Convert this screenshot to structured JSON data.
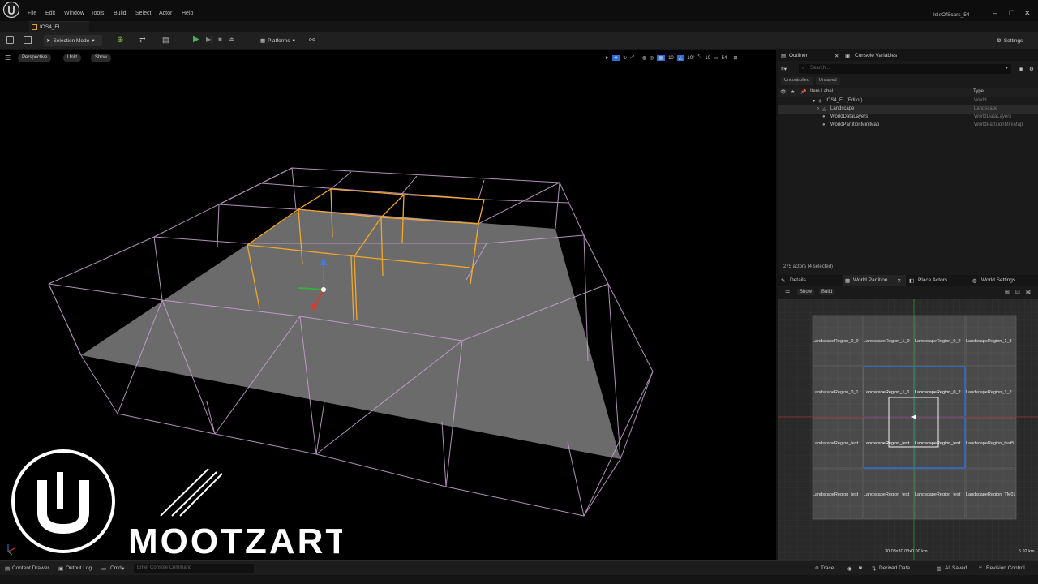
{
  "menu": [
    "File",
    "Edit",
    "Window",
    "Tools",
    "Build",
    "Select",
    "Actor",
    "Help"
  ],
  "project_name": "IsleOfScars_54",
  "level_tab": "IOS4_EL",
  "toolbar": {
    "selection_mode": "Selection Mode",
    "platforms": "Platforms",
    "settings": "Settings"
  },
  "viewport": {
    "perspective": "Perspective",
    "lit": "Unlit",
    "show": "Show",
    "grid_snap": "10",
    "rot_snap": "10°",
    "scale_snap": "10",
    "camera_speed": "54"
  },
  "watermark": "MOOTZART",
  "outliner": {
    "tab": "Outliner",
    "console_tab": "Console Variables",
    "search_placeholder": "Search...",
    "filter_uncontrolled": "Uncontrolled",
    "filter_unsaved": "Unsaved",
    "col_label": "Item Label",
    "col_type": "Type",
    "rows": [
      {
        "label": "IOS4_EL (Editor)",
        "type": "World"
      },
      {
        "label": "Landscape",
        "type": "Landscape"
      },
      {
        "label": "WorldDataLayers",
        "type": "WorldDataLayers"
      },
      {
        "label": "WorldPartitionMiniMap",
        "type": "WorldPartitionMiniMap"
      }
    ],
    "actor_count": "275 actors (4 selected)"
  },
  "details_tabs": {
    "details": "Details",
    "world_partition": "World Partition",
    "place_actors": "Place Actors",
    "world_settings": "World Settings"
  },
  "wp": {
    "show": "Show",
    "build": "Build",
    "cell_labels": [
      [
        "LandscapeRegion_0_0",
        "LandscapeRegion_1_0",
        "LandscapeRegion_0_2",
        "LandscapeRegion_1_3"
      ],
      [
        "LandscapeRegion_0_1",
        "LandscapeRegion_1_1",
        "LandscapeRegion_0_2",
        "LandscapeRegion_1_2"
      ],
      [
        "LandscapeRegion_test",
        "LandscapeRegion_test",
        "LandscapeRegion_test",
        "LandscapeRegion_test5"
      ],
      [
        "LandscapeRegion_test",
        "LandscapeRegion_test",
        "LandscapeRegion_test",
        "LandscapeRegion_TM01"
      ]
    ],
    "coords": "30.03x30.03x0.00 km",
    "scale": "5.92 km"
  },
  "status": {
    "content_drawer": "Content Drawer",
    "output_log": "Output Log",
    "cmd": "Cmd",
    "console_placeholder": "Enter Console Command",
    "trace": "Trace",
    "derived_data": "Derived Data",
    "all_saved": "All Saved",
    "revision_control": "Revision Control"
  },
  "colors": {
    "wire": "#c7a0cf",
    "selected": "#f2a629",
    "plane": "#6b6b6b",
    "wp_select": "#2c6fd6"
  }
}
